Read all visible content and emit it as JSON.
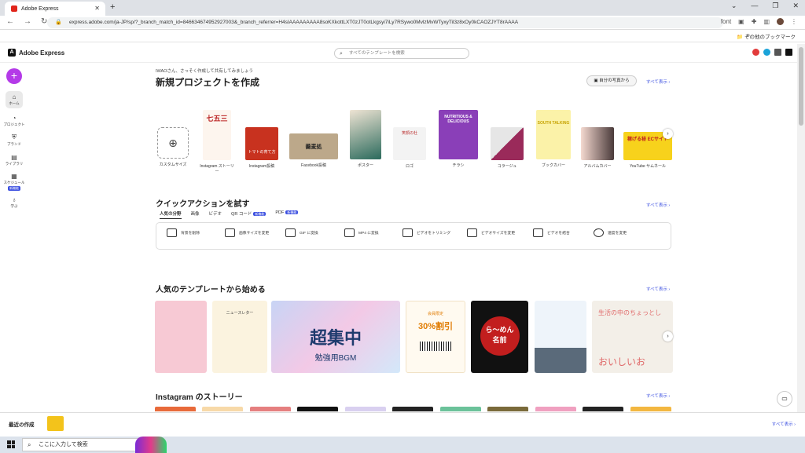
{
  "browser": {
    "tab_title": "Adobe Express",
    "url": "express.adobe.com/ja-JP/sp/?_branch_match_id=846634674952927003&_branch_referrer=H4sIAAAAAAAAA8soKXkottLXT0zJT0otLkgsyi7iLy7RSywo0MvlzMvWTyxyTil3z8xOy0kCAOZJYT8rAAAA",
    "bookmark_folder": "その他のブックマーク",
    "ext_label": "font"
  },
  "app": {
    "name": "Adobe Express",
    "search_placeholder": "すべてのテンプレートを検索"
  },
  "sidebar": {
    "items": [
      {
        "label": "ホーム",
        "icon": "home-icon"
      },
      {
        "label": "プロジェクト",
        "icon": "folder-icon"
      },
      {
        "label": "ブランド",
        "icon": "brand-icon"
      },
      {
        "label": "ライブラリ",
        "icon": "library-icon"
      },
      {
        "label": "スケジュール",
        "icon": "calendar-icon",
        "badge": "新機能"
      },
      {
        "label": "学ぶ",
        "icon": "lightbulb-icon"
      }
    ]
  },
  "main": {
    "greeting": "IWAOさん、さっそく作成して共有してみましょう",
    "title": "新規プロジェクトを作成",
    "photo_button": "自分の写真から",
    "see_all": "すべて表示",
    "projects": [
      {
        "label": "カスタムサイズ"
      },
      {
        "label": "Instagram ストーリー",
        "thumb_text": "七五三"
      },
      {
        "label": "Instagram投稿",
        "thumb_text": "トマトの育て方"
      },
      {
        "label": "Facebook投稿",
        "thumb_text": "蕎麦処"
      },
      {
        "label": "ポスター"
      },
      {
        "label": "ロゴ",
        "thumb_text": "笑顔の杜"
      },
      {
        "label": "チラシ",
        "thumb_text": "NUTRITIOUS & DELICIOUS"
      },
      {
        "label": "コラージュ"
      },
      {
        "label": "ブックカバー",
        "thumb_text": "SOUTH TALKING"
      },
      {
        "label": "アルバムカバー"
      },
      {
        "label": "YouTube サムネール",
        "thumb_text": "稼げる秘 ECサイト"
      }
    ]
  },
  "quick": {
    "title": "クイックアクションを試す",
    "see_all": "すべて表示",
    "tabs": [
      {
        "label": "人気の分野"
      },
      {
        "label": "画像"
      },
      {
        "label": "ビデオ"
      },
      {
        "label": "QR コード",
        "badge": "新機能"
      },
      {
        "label": "PDF",
        "badge": "新機能"
      }
    ],
    "actions": [
      {
        "label": "背景を削除",
        "icon": "remove-background-icon"
      },
      {
        "label": "画像サイズを変更",
        "icon": "resize-image-icon"
      },
      {
        "label": "GIF に変換",
        "icon": "gif-convert-icon"
      },
      {
        "label": "MP4 に変換",
        "icon": "mp4-convert-icon"
      },
      {
        "label": "ビデオをトリミング",
        "icon": "trim-video-icon"
      },
      {
        "label": "ビデオサイズを変更",
        "icon": "resize-video-icon"
      },
      {
        "label": "ビデオを結合",
        "icon": "merge-video-icon"
      },
      {
        "label": "速度を変更",
        "icon": "speed-icon"
      }
    ]
  },
  "popular": {
    "title": "人気のテンプレートから始める",
    "see_all": "すべて表示",
    "templates": [
      {
        "text": ""
      },
      {
        "text": "ニュースレター"
      },
      {
        "text": "超集中",
        "sub": "勉強用BGM"
      },
      {
        "text": "30%割引",
        "sub": "会員限定"
      },
      {
        "text": "ら〜めん",
        "sub": "名前"
      },
      {
        "text": ""
      },
      {
        "text": "生活の中のちょっとし",
        "sub": "おいしいお"
      }
    ]
  },
  "instagram": {
    "title": "Instagram のストーリー",
    "see_all": "すべて表示"
  },
  "recent": {
    "label": "最近の作成",
    "see_all": "すべて表示"
  },
  "taskbar": {
    "search_placeholder": "ここに入力して検索"
  },
  "colors": {
    "accent": "#3b4fe0",
    "create": "#b43ae8"
  }
}
